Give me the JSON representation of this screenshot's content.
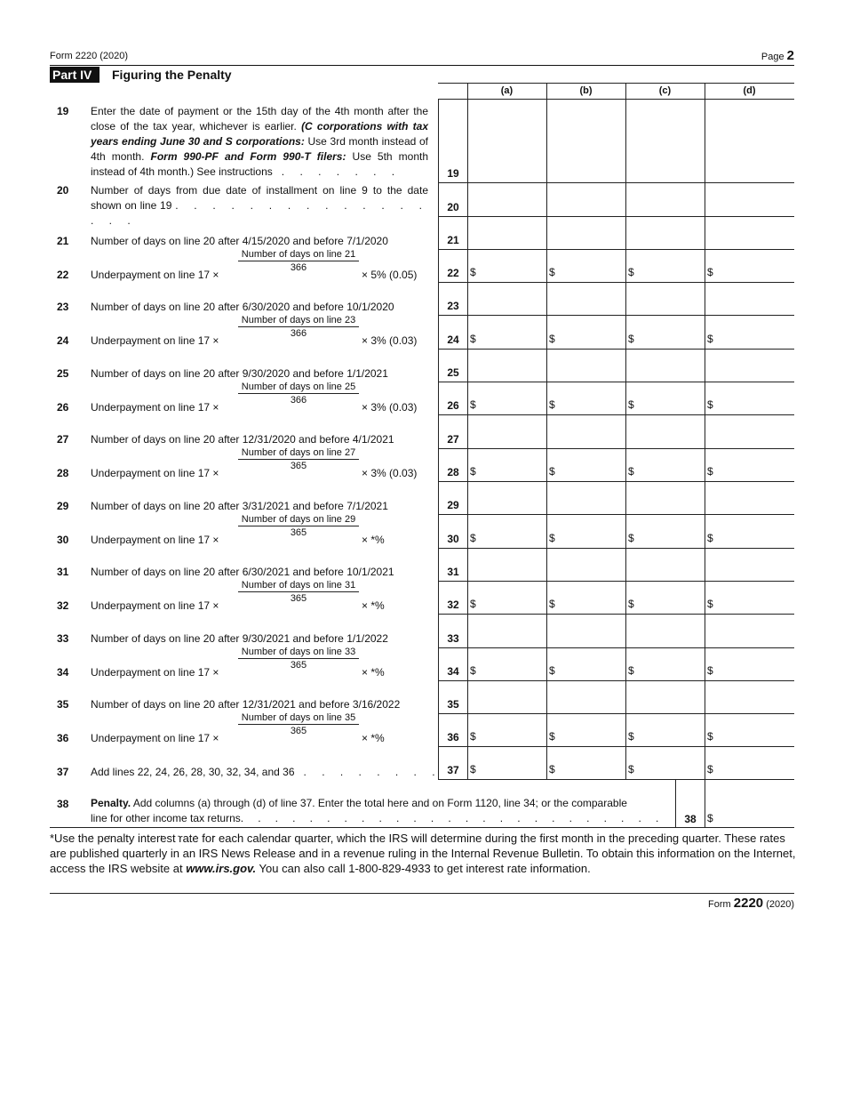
{
  "header": {
    "form_id": "Form 2220 (2020)",
    "page_label": "Page",
    "page_number": "2"
  },
  "part": {
    "tag": "Part IV",
    "title": "Figuring the Penalty"
  },
  "columns": [
    "(a)",
    "(b)",
    "(c)",
    "(d)"
  ],
  "line19": {
    "num": "19",
    "text_1": "Enter the date of payment or the 15th day of the 4th month after the close of the tax year, whichever is earlier. ",
    "text_bold_1": "(C corporations with tax years ending June 30 and S corporations:",
    "text_2": " Use 3rd month instead of 4th month. ",
    "text_bold_2": "Form 990-PF and Form 990-T filers:",
    "text_3": " Use 5th month instead of 4th month.) See instructions",
    "dots": ". . . . . . ."
  },
  "line20": {
    "num": "20",
    "text": "Number of days from due date of installment on line 9 to the date shown on line 19",
    "dots": ". . . . . . . . . . . . . . . . ."
  },
  "day_lines": [
    {
      "num": "21",
      "text": "Number of days on line 20 after 4/15/2020 and before 7/1/2020"
    },
    {
      "num": "23",
      "text": "Number of days on line 20 after 6/30/2020 and before 10/1/2020"
    },
    {
      "num": "25",
      "text": "Number of days on line 20 after 9/30/2020 and before 1/1/2021"
    },
    {
      "num": "27",
      "text": "Number of days on line 20 after 12/31/2020 and before 4/1/2021"
    },
    {
      "num": "29",
      "text": "Number of days on line 20 after 3/31/2021 and before 7/1/2021"
    },
    {
      "num": "31",
      "text": "Number of days on line 20 after 6/30/2021 and before 10/1/2021"
    },
    {
      "num": "33",
      "text": "Number of days on line 20 after 9/30/2021 and before 1/1/2022"
    },
    {
      "num": "35",
      "text": "Number of days on line 20 after 12/31/2021 and before 3/16/2022"
    }
  ],
  "penalty_lines": [
    {
      "num": "22",
      "text": "Underpayment on line 17 ×",
      "numerator": "Number of days on line 21",
      "denominator": "366",
      "rate": "× 5% (0.05)"
    },
    {
      "num": "24",
      "text": "Underpayment on line 17 ×",
      "numerator": "Number of days on line 23",
      "denominator": "366",
      "rate": "× 3% (0.03)"
    },
    {
      "num": "26",
      "text": "Underpayment on line 17 ×",
      "numerator": "Number of days on line 25",
      "denominator": "366",
      "rate": "× 3% (0.03)"
    },
    {
      "num": "28",
      "text": "Underpayment on line 17 ×",
      "numerator": "Number of days on line 27",
      "denominator": "365",
      "rate": "× 3% (0.03)"
    },
    {
      "num": "30",
      "text": "Underpayment on line 17 ×",
      "numerator": "Number of days on line 29",
      "denominator": "365",
      "rate": "× *%"
    },
    {
      "num": "32",
      "text": "Underpayment on line 17 ×",
      "numerator": "Number of days on line 31",
      "denominator": "365",
      "rate": "× *%"
    },
    {
      "num": "34",
      "text": "Underpayment on line 17 ×",
      "numerator": "Number of days on line 33",
      "denominator": "365",
      "rate": "× *%"
    },
    {
      "num": "36",
      "text": "Underpayment on line 17 ×",
      "numerator": "Number of days on line 35",
      "denominator": "365",
      "rate": "× *%"
    }
  ],
  "line37": {
    "num": "37",
    "text": "Add lines 22, 24, 26, 28, 30, 32, 34, and 36",
    "dots": ". . . . . . . ."
  },
  "line38": {
    "num": "38",
    "bold": "Penalty.",
    "text_1": " Add columns (a) through (d) of line 37. Enter the total here and on Form 1120, line 34; or the comparable",
    "text_2": "line for other income tax returns",
    "dots": ". . . . . . . . . . . . . . . . . . . . . . . . . . . . . . . . ."
  },
  "currency_symbol": "$",
  "footnote": {
    "text_1": "*Use the penalty interest rate for each calendar quarter, which the IRS will determine during the first month in the preceding quarter. These rates are published quarterly in an IRS News Release and in a revenue ruling in the Internal Revenue Bulletin. To obtain this information on the Internet, access the IRS website at ",
    "link": "www.irs.gov.",
    "text_2": " You can also call 1-800-829-4933 to get interest rate information."
  },
  "footer": {
    "prefix": "Form",
    "form_number": "2220",
    "year": "(2020)"
  }
}
